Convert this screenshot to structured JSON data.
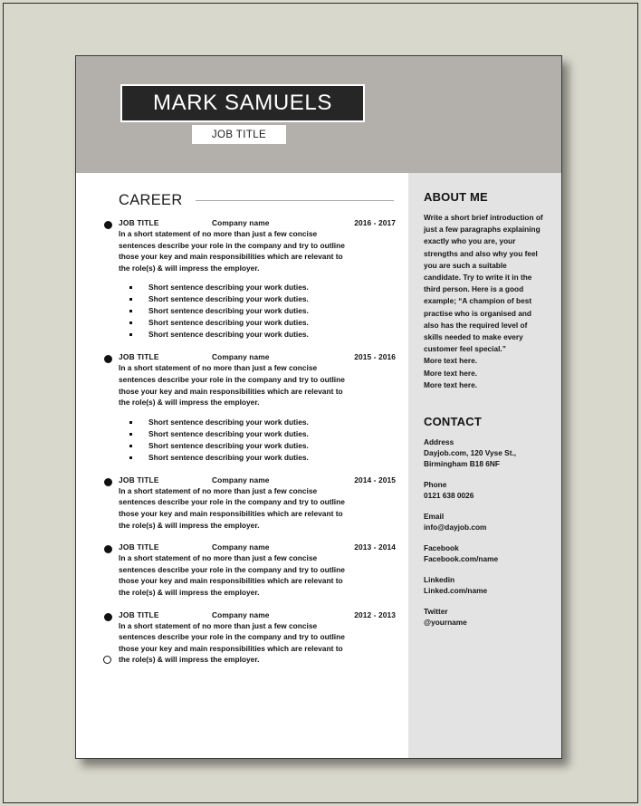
{
  "document": {
    "header": {
      "name": "MARK SAMUELS",
      "job_title": "JOB TITLE"
    },
    "main": {
      "section_title": "CAREER",
      "entries": [
        {
          "title": "JOB TITLE",
          "company": "Company name",
          "dates": "2016 - 2017",
          "description": "In a short statement of no more than just a few concise sentences describe your role in the company and try to outline those your key and main responsibilities which are relevant to the role(s) & will impress the employer.",
          "bullets": [
            "Short sentence describing your work duties.",
            "Short sentence describing your work duties.",
            "Short sentence describing your work duties.",
            "Short sentence describing your work duties.",
            "Short sentence describing your work duties."
          ]
        },
        {
          "title": "JOB TITLE",
          "company": "Company name",
          "dates": "2015 - 2016",
          "description": "In a short statement of no more than just a few concise sentences describe your role in the company and try to outline those your key and main responsibilities which are relevant to the role(s) & will impress the employer.",
          "bullets": [
            "Short sentence describing your work duties.",
            "Short sentence describing your work duties.",
            "Short sentence describing your work duties.",
            "Short sentence describing your work duties."
          ]
        },
        {
          "title": "JOB TITLE",
          "company": "Company name",
          "dates": "2014 - 2015",
          "description": "In a short statement of no more than just a few concise sentences describe your role in the company and try to outline those your key and main responsibilities which are relevant to the role(s) & will impress the employer.",
          "bullets": []
        },
        {
          "title": "JOB TITLE",
          "company": "Company name",
          "dates": "2013 - 2014",
          "description": "In a short statement of no more than just a few concise sentences describe your role in the company and try to outline those your key and main responsibilities which are relevant to the role(s) & will impress the employer.",
          "bullets": []
        },
        {
          "title": "JOB TITLE",
          "company": "Company name",
          "dates": "2012 - 2013",
          "description": "In a short statement of no more than just a few concise sentences describe your role in the company and try to outline those your key and main responsibilities which are relevant to the role(s) & will impress the employer.",
          "bullets": []
        }
      ]
    },
    "sidebar": {
      "about": {
        "title": "ABOUT ME",
        "paragraph": "Write a short brief introduction of just a few paragraphs explaining exactly who you are, your strengths and also why you feel you are such a suitable candidate. Try to write it in the third person. Here is a good example; “A champion of best practise who is organised and also has the required level of skills needed to make every customer feel special.”",
        "more_lines": [
          "More text here.",
          "More text here.",
          "More text here."
        ]
      },
      "contact": {
        "title": "CONTACT",
        "groups": [
          {
            "label": "Address",
            "lines": [
              "Dayjob.com, 120 Vyse St.,",
              "Birmingham B18 6NF"
            ]
          },
          {
            "label": "Phone",
            "lines": [
              "0121 638 0026"
            ]
          },
          {
            "label": "Email",
            "lines": [
              "info@dayjob.com"
            ]
          },
          {
            "label": "Facebook",
            "lines": [
              "Facebook.com/name"
            ]
          },
          {
            "label": "Linkedin",
            "lines": [
              "Linked.com/name"
            ]
          },
          {
            "label": "Twitter",
            "lines": [
              "@yourname"
            ]
          }
        ]
      }
    }
  },
  "colors": {
    "page_background": "#d9d8cc",
    "header_band": "#b3afab",
    "name_box": "#262626",
    "sidebar": "#e4e3e3",
    "document": "#ffffff",
    "text": "#111111"
  }
}
